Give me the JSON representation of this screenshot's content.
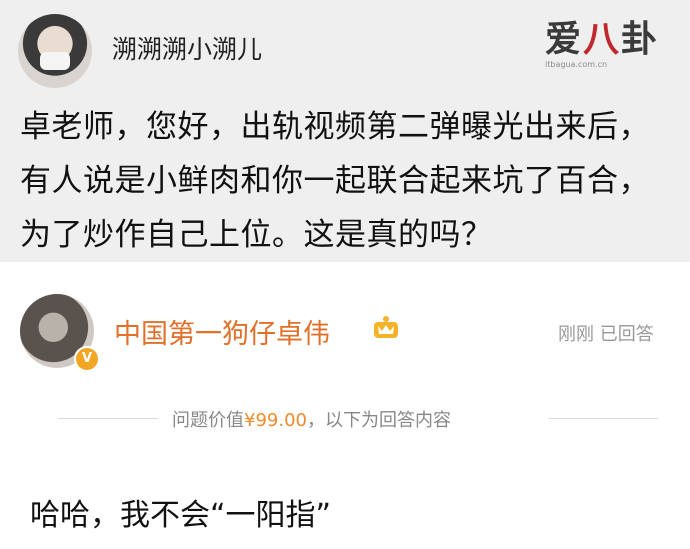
{
  "question": {
    "asker_name": "溯溯溯小溯儿",
    "text": "卓老师，您好，出轨视频第二弹曝光出来后，有人说是小鲜肉和你一起联合起来坑了百合，为了炒作自己上位。这是真的吗？"
  },
  "watermark": {
    "logo_main": "爱",
    "logo_accent": "八",
    "logo_tail": "卦",
    "url": "itbagua.com.cn"
  },
  "answer": {
    "answerer_name": "中国第一狗仔卓伟",
    "status": "刚刚 已回答",
    "price_prefix": "问题价值",
    "price_value": "¥99.00",
    "price_suffix": "，以下为回答内容",
    "text": "哈哈，我不会“一阳指”"
  },
  "colors": {
    "question_bg": "#efefef",
    "answerer_name": "#e0702a",
    "price_value": "#f08a2a",
    "muted": "#999999"
  },
  "icons": {
    "verified": "verified-v-icon",
    "vip": "vip-crown-icon"
  }
}
